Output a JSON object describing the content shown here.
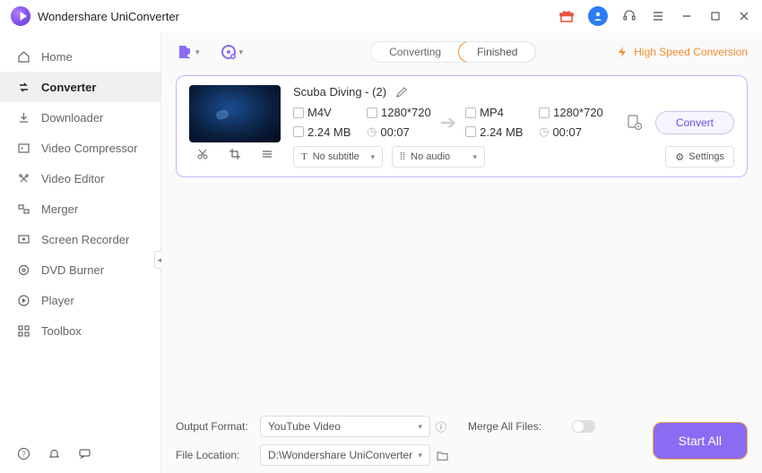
{
  "header": {
    "app_title": "Wondershare UniConverter"
  },
  "titlebar_icons": {
    "gift": "gift-icon",
    "avatar": "user-avatar",
    "headset": "support-icon",
    "menu": "menu-icon",
    "min": "minimize-icon",
    "max": "maximize-icon",
    "close": "close-icon"
  },
  "sidebar": {
    "items": [
      {
        "label": "Home",
        "icon": "home-icon"
      },
      {
        "label": "Converter",
        "icon": "converter-icon"
      },
      {
        "label": "Downloader",
        "icon": "downloader-icon"
      },
      {
        "label": "Video Compressor",
        "icon": "compressor-icon"
      },
      {
        "label": "Video Editor",
        "icon": "editor-icon"
      },
      {
        "label": "Merger",
        "icon": "merger-icon"
      },
      {
        "label": "Screen Recorder",
        "icon": "recorder-icon"
      },
      {
        "label": "DVD Burner",
        "icon": "burner-icon"
      },
      {
        "label": "Player",
        "icon": "player-icon"
      },
      {
        "label": "Toolbox",
        "icon": "toolbox-icon"
      }
    ],
    "bottom": {
      "help": "help-icon",
      "notify": "notify-icon",
      "feedback": "feedback-icon"
    }
  },
  "tabs": {
    "converting": "Converting",
    "finished": "Finished"
  },
  "hsc": {
    "label": "High Speed Conversion"
  },
  "file_card": {
    "title": "Scuba Diving - (2)",
    "edit_icon": "edit-icon",
    "source": {
      "format": "M4V",
      "resolution": "1280*720",
      "size": "2.24 MB",
      "duration": "00:07"
    },
    "target": {
      "format": "MP4",
      "resolution": "1280*720",
      "size": "2.24 MB",
      "duration": "00:07"
    },
    "subtitle_label": "No subtitle",
    "audio_label": "No audio",
    "settings_label": "Settings",
    "convert_label": "Convert",
    "thumb_tools": {
      "cut": "cut-icon",
      "crop": "crop-icon",
      "more": "more-icon"
    }
  },
  "bottom": {
    "output_format_label": "Output Format:",
    "output_format_value": "YouTube Video",
    "file_location_label": "File Location:",
    "file_location_value": "D:\\Wondershare UniConverter",
    "merge_label": "Merge All Files:",
    "start_all": "Start All"
  }
}
